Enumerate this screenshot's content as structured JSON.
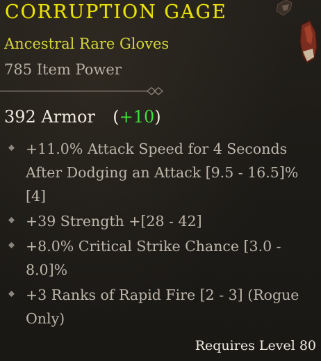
{
  "item": {
    "name": "CORRUPTION GAGE",
    "type": "Ancestral Rare Gloves",
    "item_power": "785 Item Power"
  },
  "armor": {
    "value": "392 Armor",
    "bonus_open": "(",
    "bonus": "+10",
    "bonus_close": ")"
  },
  "affixes": [
    "+11.0% Attack Speed for 4 Seconds After Dodging an Attack [9.5 - 16.5]%[4]",
    "+39 Strength +[28 - 42]",
    "+8.0% Critical Strike Chance [3.0 - 8.0]%",
    "+3 Ranks of Rapid Fire [2 - 3] (Rogue Only)"
  ],
  "requirement": "Requires Level 80",
  "colors": {
    "name": "#ece20a",
    "type": "#d6d63a",
    "bonus": "#3fe23a",
    "text": "#bdb6aa"
  },
  "icons": {
    "bullet": "diamond-bullet-icon",
    "divider": "ornate-divider-icon",
    "item": "glove-icon"
  }
}
